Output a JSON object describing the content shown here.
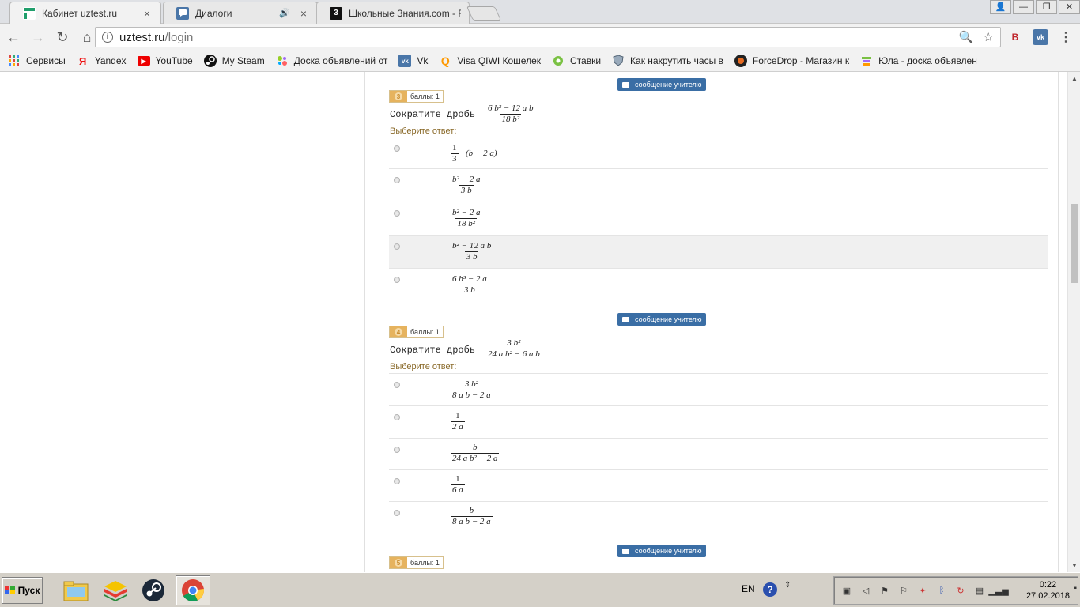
{
  "tabs": [
    {
      "title": "Кабинет uztest.ru",
      "close": "×",
      "favicon": "uztest-icon"
    },
    {
      "title": "Диалоги",
      "close": "×",
      "audio": "🔊",
      "favicon": "vk-messages-icon"
    },
    {
      "title": "Школьные Знания.com - F",
      "favicon": "znania-icon",
      "favicon_text": "3"
    }
  ],
  "window": {
    "user": "👤",
    "minimize": "—",
    "restore": "❐",
    "close": "✕"
  },
  "nav": {
    "back": "←",
    "forward": "→",
    "reload": "↻",
    "home": "⌂"
  },
  "omnibox": {
    "host": "uztest.ru",
    "path": "/login",
    "info": "i",
    "zoom": "🔍",
    "star": "☆"
  },
  "extensions": {
    "b": "B",
    "vk": "vk",
    "menu": "⋮"
  },
  "bookmarks": [
    {
      "label": "Сервисы",
      "icon": "apps-grid-icon"
    },
    {
      "label": "Yandex",
      "icon": "yandex-icon",
      "glyph": "Я"
    },
    {
      "label": "YouTube",
      "icon": "youtube-icon",
      "glyph": "▶"
    },
    {
      "label": "My Steam",
      "icon": "steam-icon"
    },
    {
      "label": "Доска объявлений от",
      "icon": "avito-icon"
    },
    {
      "label": "Vk",
      "icon": "vk-icon",
      "glyph": "vk"
    },
    {
      "label": "Visa QIWI Кошелек",
      "icon": "qiwi-icon",
      "glyph": "Q"
    },
    {
      "label": "Ставки",
      "icon": "football-icon"
    },
    {
      "label": "Как накрутить часы в",
      "icon": "shield-icon"
    },
    {
      "label": "ForceDrop - Магазин к",
      "icon": "forcedrop-icon"
    },
    {
      "label": "Юла - доска объявлен",
      "icon": "yula-icon"
    }
  ],
  "questions": [
    {
      "number": "3",
      "score": "баллы: 1",
      "message_btn": "сообщение   учителю",
      "prompt": "Сократите дробь",
      "frac": {
        "num": "6 b³ − 12 a b",
        "den": "18 b²"
      },
      "hint": "Выберите ответ:",
      "options": [
        {
          "num": "1",
          "den": "3",
          "tail": "(b − 2 a)"
        },
        {
          "num": "b² − 2 a",
          "den": "3 b"
        },
        {
          "num": "b² − 2 a",
          "den": "18 b²"
        },
        {
          "num": "b² − 12 a b",
          "den": "3 b"
        },
        {
          "num": "6 b³ − 2 a",
          "den": "3 b"
        }
      ]
    },
    {
      "number": "4",
      "score": "баллы: 1",
      "message_btn": "сообщение   учителю",
      "prompt": "Сократите дробь",
      "frac": {
        "num": "3 b²",
        "den": "24 a b² − 6 a b"
      },
      "hint": "Выберите ответ:",
      "options": [
        {
          "num": "3 b²",
          "den": "8 a b − 2 a"
        },
        {
          "num": "1",
          "den": "2 a"
        },
        {
          "num": "b",
          "den": "24 a b² − 2 a"
        },
        {
          "num": "1",
          "den": "6 a"
        },
        {
          "num": "b",
          "den": "8 a b − 2 a"
        }
      ]
    },
    {
      "number": "5",
      "score": "баллы: 1",
      "message_btn": "сообщение   учителю"
    }
  ],
  "taskbar": {
    "start": "Пуск",
    "lang": "EN",
    "help": "?",
    "time": "0:22",
    "date": "27.02.2018"
  }
}
